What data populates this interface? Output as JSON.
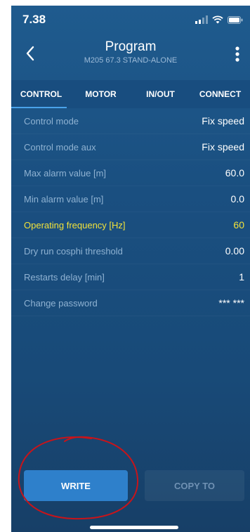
{
  "status_bar": {
    "time": "7.38"
  },
  "header": {
    "title": "Program",
    "subtitle": "M205 67.3 STAND-ALONE",
    "back_icon": "chevron-left-icon",
    "menu_icon": "more-vertical-icon"
  },
  "tabs": [
    {
      "label": "CONTROL",
      "active": true
    },
    {
      "label": "MOTOR",
      "active": false
    },
    {
      "label": "IN/OUT",
      "active": false
    },
    {
      "label": "CONNECT",
      "active": false
    }
  ],
  "settings": [
    {
      "label": "Control mode",
      "value": "Fix speed"
    },
    {
      "label": "Control mode aux",
      "value": "Fix speed"
    },
    {
      "label": "Max alarm value [m]",
      "value": "60.0"
    },
    {
      "label": "Min alarm value [m]",
      "value": "0.0"
    },
    {
      "label": "Operating frequency [Hz]",
      "value": "60"
    },
    {
      "label": "Dry run cosphi threshold",
      "value": "0.00"
    },
    {
      "label": "Restarts delay [min]",
      "value": "1"
    },
    {
      "label": "Change password",
      "value": "*** ***"
    }
  ],
  "buttons": {
    "write_label": "WRITE",
    "copy_label": "COPY TO"
  },
  "colors": {
    "background": "#1a4f80",
    "highlight": "#f2e23a",
    "accent": "#2e80cb",
    "annotation": "#c8141a"
  }
}
